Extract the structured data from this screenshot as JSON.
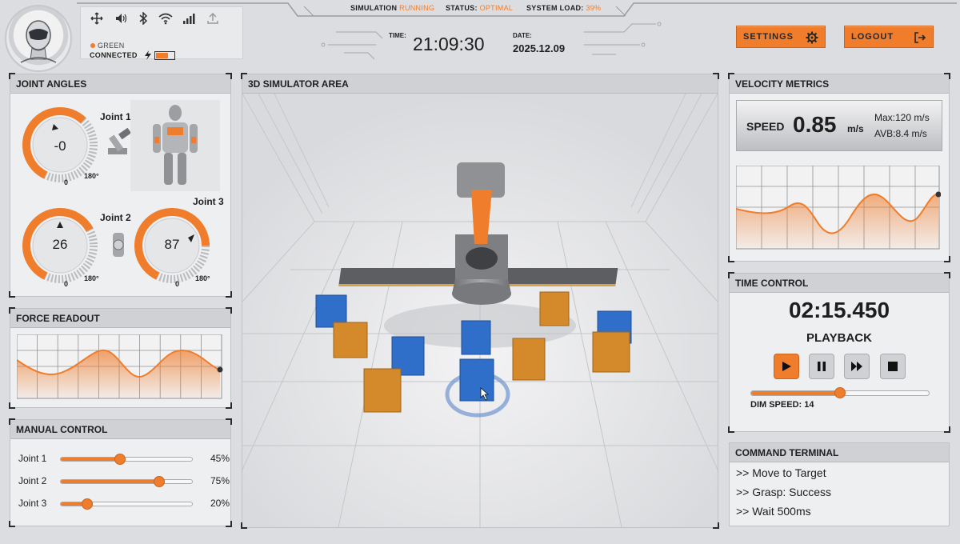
{
  "status": {
    "link_color_label": "GREEN",
    "link_state": "CONNECTED",
    "simulation_label": "SIMULATION",
    "simulation_value": "RUNNING",
    "status_label": "STATUS:",
    "status_value": "OPTIMAL",
    "load_label": "SYSTEM LOAD:",
    "load_value": "39%",
    "battery_level": 0.7
  },
  "clock": {
    "time_label": "TIME:",
    "time": "21:09:30",
    "date_label": "DATE:",
    "date": "2025.12.09"
  },
  "buttons": {
    "settings": "SETTINGS",
    "logout": "LOGOUT"
  },
  "joint_angles": {
    "title": "JOINT ANGLES",
    "joints": [
      {
        "label": "Joint 1",
        "value": "-0",
        "min": "0",
        "max": "180°"
      },
      {
        "label": "Joint 2",
        "value": "26",
        "min": "0",
        "max": "180°"
      },
      {
        "label": "Joint 3",
        "value": "87",
        "min": "0",
        "max": "180°"
      }
    ]
  },
  "force": {
    "title": "FORCE READOUT"
  },
  "manual": {
    "title": "MANUAL CONTROL",
    "rows": [
      {
        "label": "Joint 1",
        "value": 45,
        "display": "45%"
      },
      {
        "label": "Joint 2",
        "value": 75,
        "display": "75%"
      },
      {
        "label": "Joint 3",
        "value": 20,
        "display": "20%"
      }
    ]
  },
  "simulator": {
    "title": "3D SIMULATOR AREA"
  },
  "velocity": {
    "title": "VELOCITY METRICS",
    "speed_label": "SPEED",
    "speed_value": "0.85",
    "speed_unit": "m/s",
    "max": "Max:120 m/s",
    "avg": "AVB:8.4 m/s"
  },
  "time_control": {
    "title": "TIME CONTROL",
    "time": "02:15.450",
    "mode": "PLAYBACK",
    "dim_speed": "DIM SPEED: 14",
    "speed_fraction": 0.5
  },
  "terminal": {
    "title": "COMMAND TERMINAL",
    "lines": [
      ">> Move to Target",
      ">> Grasp: Success",
      ">> Wait 500ms"
    ]
  },
  "colors": {
    "accent": "#ef7d2c",
    "cube_blue": "#2f6fc9",
    "cube_orange": "#d48a2a"
  }
}
